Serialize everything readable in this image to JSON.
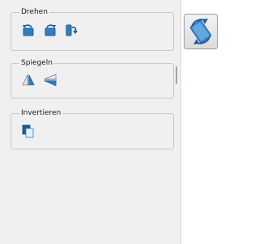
{
  "groups": {
    "rotate": {
      "title": "Drehen",
      "buttons": [
        {
          "icon": "rotate-left-icon"
        },
        {
          "icon": "rotate-right-icon"
        },
        {
          "icon": "rotate-flip-icon"
        }
      ]
    },
    "mirror": {
      "title": "Spiegeln",
      "buttons": [
        {
          "icon": "mirror-horizontal-icon"
        },
        {
          "icon": "mirror-vertical-icon"
        }
      ]
    },
    "invert": {
      "title": "Invertieren",
      "buttons": [
        {
          "icon": "invert-icon"
        }
      ]
    }
  },
  "side_button": {
    "icon": "rotate-transform-icon"
  },
  "colors": {
    "icon_blue": "#2f7fc1",
    "icon_blue_dark": "#1b5c99",
    "panel_bg": "#f0f0f0",
    "group_border": "#c8c8c8"
  }
}
